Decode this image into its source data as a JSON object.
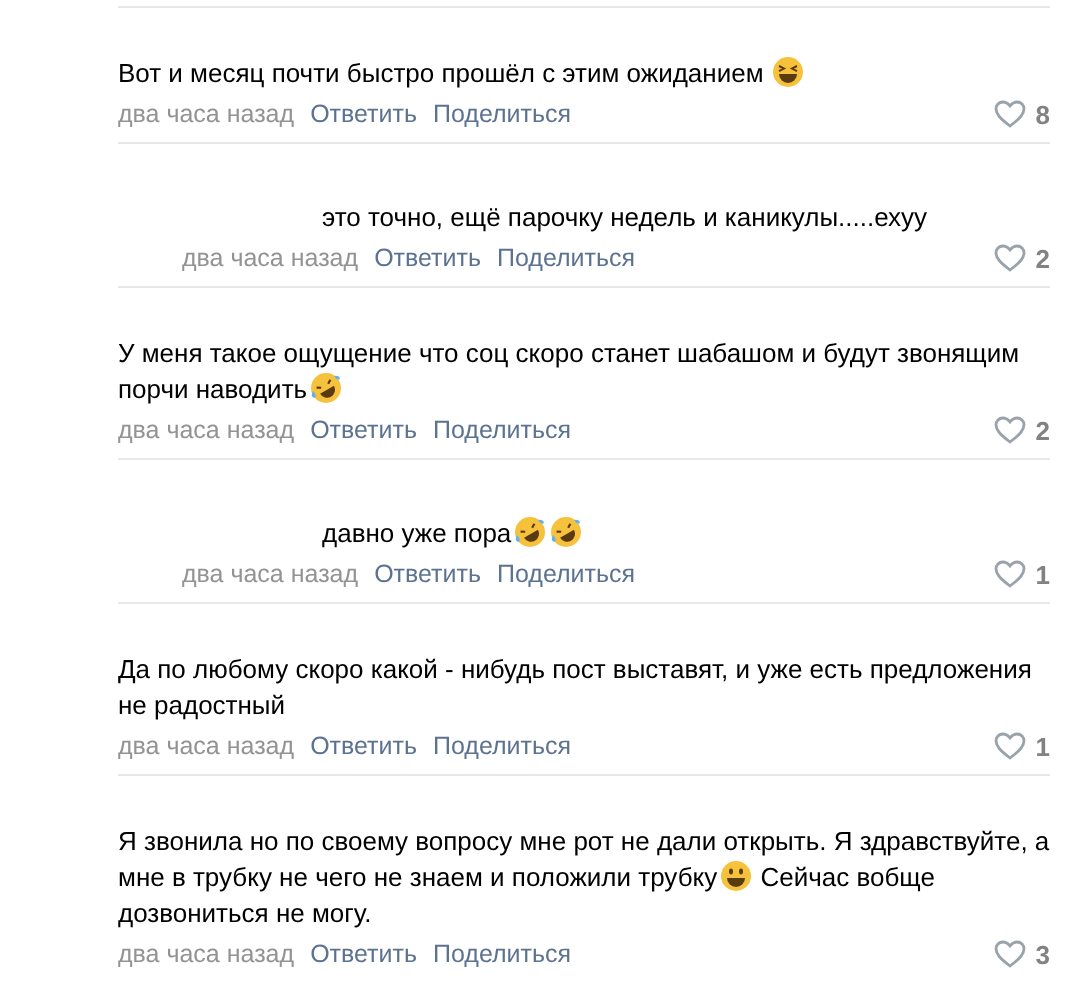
{
  "comments": [
    {
      "kind": "comment",
      "body": [
        {
          "kind": "text",
          "text": "Вот и месяц почти быстро прошёл с этим ожиданием "
        },
        {
          "kind": "emoji-squint"
        }
      ],
      "time": "два часа назад",
      "reply": "Ответить",
      "share": "Поделиться",
      "likes": "8"
    },
    {
      "kind": "reply",
      "body": [
        {
          "kind": "text",
          "text": "это точно, ещё парочку недель и каникулы.....ехуу"
        }
      ],
      "time": "два часа назад",
      "reply": "Ответить",
      "share": "Поделиться",
      "likes": "2"
    },
    {
      "kind": "comment",
      "body": [
        {
          "kind": "text",
          "text": "У меня такое ощущение что соц скоро станет шабашом и будут звонящим порчи наводить"
        },
        {
          "kind": "emoji-rofl"
        }
      ],
      "time": "два часа назад",
      "reply": "Ответить",
      "share": "Поделиться",
      "likes": "2"
    },
    {
      "kind": "reply",
      "body": [
        {
          "kind": "text",
          "text": "давно уже пора"
        },
        {
          "kind": "emoji-rofl"
        },
        {
          "kind": "emoji-rofl"
        }
      ],
      "time": "два часа назад",
      "reply": "Ответить",
      "share": "Поделиться",
      "likes": "1"
    },
    {
      "kind": "comment",
      "body": [
        {
          "kind": "text",
          "text": "Да по любому скоро какой - нибудь пост выставят, и уже есть предложения не радостный"
        }
      ],
      "time": "два часа назад",
      "reply": "Ответить",
      "share": "Поделиться",
      "likes": "1"
    },
    {
      "kind": "comment",
      "body": [
        {
          "kind": "text",
          "text": "Я звонила но по своему вопросу мне рот не дали открыть. Я здравствуйте, а мне в трубку не чего не знаем и положили трубку"
        },
        {
          "kind": "emoji-grin"
        },
        {
          "kind": "text",
          "text": " Сейчас вобще дозвониться не могу."
        }
      ],
      "time": "два часа назад",
      "reply": "Ответить",
      "share": "Поделиться",
      "likes": "3"
    }
  ]
}
